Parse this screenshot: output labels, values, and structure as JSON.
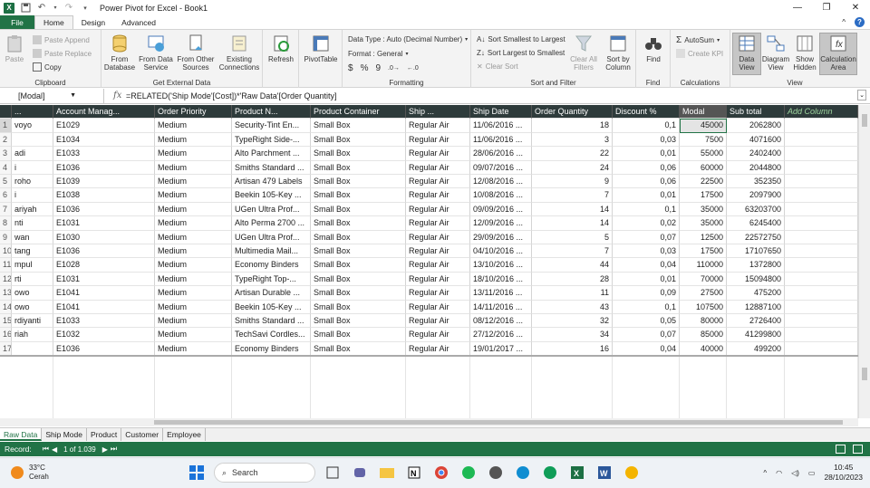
{
  "window": {
    "title": "Power Pivot for Excel - Book1"
  },
  "ribbon_tabs": [
    "File",
    "Home",
    "Design",
    "Advanced"
  ],
  "ribbon": {
    "clipboard": {
      "paste": "Paste",
      "paste_append": "Paste Append",
      "paste_replace": "Paste Replace",
      "copy": "Copy",
      "label": "Clipboard"
    },
    "external": {
      "from_database": "From\nDatabase",
      "from_data_service": "From Data\nService",
      "from_other_sources": "From Other\nSources",
      "existing_connections": "Existing\nConnections",
      "label": "Get External Data"
    },
    "refresh": "Refresh",
    "pivottable": "PivotTable",
    "formatting": {
      "data_type": "Data Type : Auto (Decimal Number)",
      "format": "Format : General",
      "currency": "$",
      "percent": "%",
      "comma": "9",
      "label": "Formatting"
    },
    "sort": {
      "asc": "Sort Smallest to Largest",
      "desc": "Sort Largest to Smallest",
      "clear_sort": "Clear Sort",
      "clear_filters": "Clear All\nFilters",
      "sort_by_column": "Sort by\nColumn",
      "label": "Sort and Filter"
    },
    "find": {
      "find": "Find",
      "label": "Find"
    },
    "calc": {
      "autosum": "AutoSum",
      "create_kpi": "Create KPI",
      "label": "Calculations"
    },
    "view": {
      "data_view": "Data\nView",
      "diagram_view": "Diagram\nView",
      "show_hidden": "Show\nHidden",
      "calc_area": "Calculation\nArea",
      "label": "View"
    }
  },
  "formula_bar": {
    "name_box": "[Modal]",
    "fx": "fx",
    "formula": "=RELATED('Ship Mode'[Cost])*'Raw Data'[Order Quantity]"
  },
  "columns": [
    "...",
    "Account Manag...",
    "Order Priority",
    "Product N...",
    "Product Container",
    "Ship ...",
    "Ship Date",
    "Order Quantity",
    "Discount %",
    "Modal",
    "Sub total",
    "Add Column"
  ],
  "rows": [
    [
      "1",
      "voyo",
      "E1029",
      "Medium",
      "Security-Tint En...",
      "Small Box",
      "Regular Air",
      "11/06/2016 ...",
      "18",
      "0,1",
      "45000",
      "2062800"
    ],
    [
      "2",
      "",
      "E1034",
      "Medium",
      "TypeRight Side-...",
      "Small Box",
      "Regular Air",
      "11/06/2016 ...",
      "3",
      "0,03",
      "7500",
      "4071600"
    ],
    [
      "3",
      "adi",
      "E1033",
      "Medium",
      "Alto Parchment ...",
      "Small Box",
      "Regular Air",
      "28/06/2016 ...",
      "22",
      "0,01",
      "55000",
      "2402400"
    ],
    [
      "4",
      "i",
      "E1036",
      "Medium",
      "Smiths Standard ...",
      "Small Box",
      "Regular Air",
      "09/07/2016 ...",
      "24",
      "0,06",
      "60000",
      "2044800"
    ],
    [
      "5",
      "roho",
      "E1039",
      "Medium",
      "Artisan 479 Labels",
      "Small Box",
      "Regular Air",
      "12/08/2016 ...",
      "9",
      "0,06",
      "22500",
      "352350"
    ],
    [
      "6",
      "i",
      "E1038",
      "Medium",
      "Beekin 105-Key ...",
      "Small Box",
      "Regular Air",
      "10/08/2016 ...",
      "7",
      "0,01",
      "17500",
      "2097900"
    ],
    [
      "7",
      "ariyah",
      "E1036",
      "Medium",
      "UGen Ultra Prof...",
      "Small Box",
      "Regular Air",
      "09/09/2016 ...",
      "14",
      "0,1",
      "35000",
      "63203700"
    ],
    [
      "8",
      "nti",
      "E1031",
      "Medium",
      "Alto Perma 2700 ...",
      "Small Box",
      "Regular Air",
      "12/09/2016 ...",
      "14",
      "0,02",
      "35000",
      "6245400"
    ],
    [
      "9",
      "wan",
      "E1030",
      "Medium",
      "UGen Ultra Prof...",
      "Small Box",
      "Regular Air",
      "29/09/2016 ...",
      "5",
      "0,07",
      "12500",
      "22572750"
    ],
    [
      "10",
      "tang",
      "E1036",
      "Medium",
      "Multimedia Mail...",
      "Small Box",
      "Regular Air",
      "04/10/2016 ...",
      "7",
      "0,03",
      "17500",
      "17107650"
    ],
    [
      "11",
      "mpul",
      "E1028",
      "Medium",
      "Economy Binders",
      "Small Box",
      "Regular Air",
      "13/10/2016 ...",
      "44",
      "0,04",
      "110000",
      "1372800"
    ],
    [
      "12",
      "rti",
      "E1031",
      "Medium",
      "TypeRight  Top-...",
      "Small Box",
      "Regular Air",
      "18/10/2016 ...",
      "28",
      "0,01",
      "70000",
      "15094800"
    ],
    [
      "13",
      "owo",
      "E1041",
      "Medium",
      "Artisan Durable ...",
      "Small Box",
      "Regular Air",
      "13/11/2016 ...",
      "11",
      "0,09",
      "27500",
      "475200"
    ],
    [
      "14",
      "owo",
      "E1041",
      "Medium",
      "Beekin 105-Key ...",
      "Small Box",
      "Regular Air",
      "14/11/2016 ...",
      "43",
      "0,1",
      "107500",
      "12887100"
    ],
    [
      "15",
      "rdiyanti",
      "E1033",
      "Medium",
      "Smiths Standard ...",
      "Small Box",
      "Regular Air",
      "08/12/2016 ...",
      "32",
      "0,05",
      "80000",
      "2726400"
    ],
    [
      "16",
      "riah",
      "E1032",
      "Medium",
      "TechSavi Cordles...",
      "Small Box",
      "Regular Air",
      "27/12/2016 ...",
      "34",
      "0,07",
      "85000",
      "41299800"
    ],
    [
      "17",
      "",
      "E1036",
      "Medium",
      "Economy Binders",
      "Small Box",
      "Regular Air",
      "19/01/2017 ...",
      "16",
      "0,04",
      "40000",
      "499200"
    ]
  ],
  "sheet_tabs": [
    "Raw Data",
    "Ship Mode",
    "Product",
    "Customer",
    "Employee"
  ],
  "status": {
    "record_label": "Record:",
    "record_pos": "1 of 1.039"
  },
  "taskbar": {
    "temp": "33°C",
    "weather": "Cerah",
    "search_placeholder": "Search",
    "time": "10:45",
    "date": "28/10/2023"
  }
}
